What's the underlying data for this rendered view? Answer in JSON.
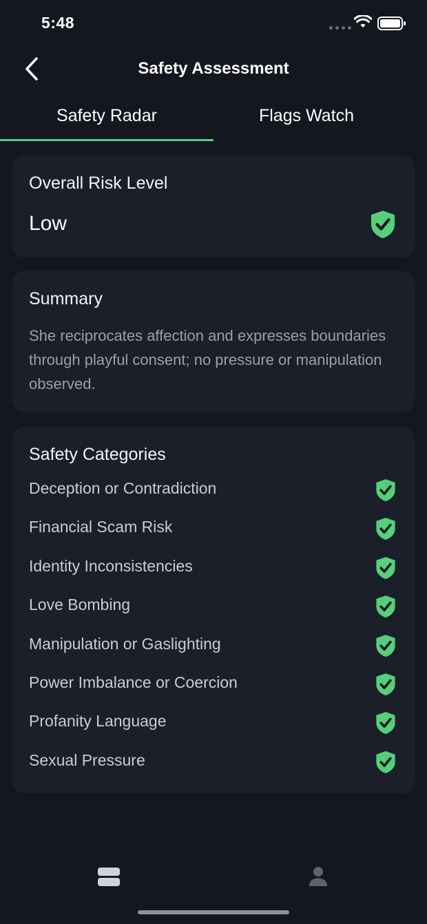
{
  "status_bar": {
    "time": "5:48",
    "icons": [
      "signal-dots-icon",
      "wifi-icon",
      "battery-icon"
    ]
  },
  "nav": {
    "back_icon": "chevron-left-icon",
    "title": "Safety Assessment"
  },
  "tabs": [
    {
      "label": "Safety Radar",
      "active": true
    },
    {
      "label": "Flags Watch",
      "active": false
    }
  ],
  "risk": {
    "heading": "Overall Risk Level",
    "value": "Low",
    "icon": "shield-check-icon"
  },
  "summary": {
    "heading": "Summary",
    "text": "She reciprocates affection and expresses boundaries through playful consent; no pressure or manipulation observed."
  },
  "categories": {
    "heading": "Safety Categories",
    "items": [
      {
        "label": "Deception or Contradiction",
        "status": "safe"
      },
      {
        "label": "Financial Scam Risk",
        "status": "safe"
      },
      {
        "label": "Identity Inconsistencies",
        "status": "safe"
      },
      {
        "label": "Love Bombing",
        "status": "safe"
      },
      {
        "label": "Manipulation or Gaslighting",
        "status": "safe"
      },
      {
        "label": "Power Imbalance or Coercion",
        "status": "safe"
      },
      {
        "label": "Profanity Language",
        "status": "safe"
      },
      {
        "label": "Sexual Pressure",
        "status": "safe"
      }
    ]
  },
  "bottom_nav": {
    "items": [
      "list-icon",
      "person-icon"
    ]
  },
  "colors": {
    "background": "#14171f",
    "card": "#1b1f29",
    "accent_green": "#55d07a",
    "muted_text": "#9aa0aa"
  }
}
